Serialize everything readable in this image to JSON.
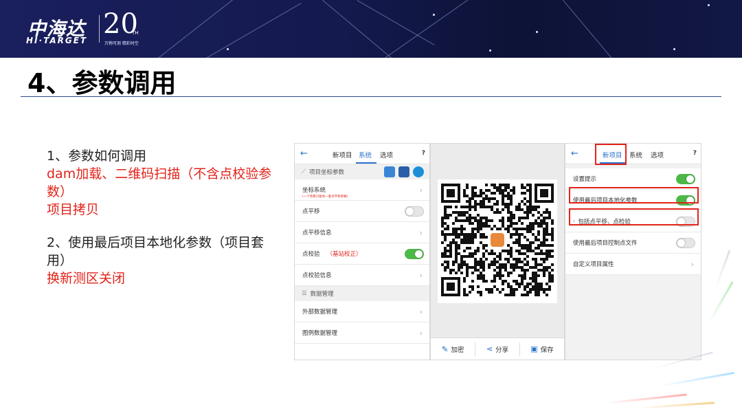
{
  "header": {
    "logo_cn": "中海达",
    "logo_en": "HI·TARGET",
    "anniv": "20",
    "anniv_suffix": "TH",
    "tagline": "万物可测 精彩时空"
  },
  "slide": {
    "title": "4、参数调用"
  },
  "left_text": {
    "item1_heading": "1、参数如何调用",
    "item1_red_a": "dam加载、二维码扫描（不含点校验参数）",
    "item1_red_b": "项目拷贝",
    "item2_heading": "2、使用最后项目本地化参数（项目套用）",
    "item2_red": "换新测区关闭"
  },
  "panel1": {
    "back": "←",
    "tabs": [
      "新项目",
      "系统",
      "选项"
    ],
    "help": "?",
    "section1": "项目坐标参数",
    "rows": [
      {
        "label": "坐标系统",
        "note": "(一个项目只能有一套点平移参数)"
      },
      {
        "label": "点平移"
      },
      {
        "label": "点平移信息"
      },
      {
        "label": "点校验",
        "extra": "（基站校正）"
      },
      {
        "label": "点校验信息"
      }
    ],
    "section2": "数据管理",
    "rows2": [
      {
        "label": "外部数据管理"
      },
      {
        "label": "图例数据管理"
      }
    ]
  },
  "panel2": {
    "buttons": [
      "加密",
      "分享",
      "保存"
    ]
  },
  "panel3": {
    "back": "←",
    "tabs": [
      "新项目",
      "系统",
      "选项"
    ],
    "help": "?",
    "rows": [
      {
        "label": "设置提示",
        "on": true
      },
      {
        "label": "使用最后项目本地化参数",
        "on": true
      },
      {
        "label": "包括点平移、点检验",
        "on": false
      },
      {
        "label": "使用最后项目控制点文件",
        "on": false
      },
      {
        "label": "自定义项目属性"
      }
    ]
  },
  "colors": {
    "accent_blue": "#2a73c9",
    "highlight_red": "#e2231a",
    "toggle_on": "#4cb848",
    "banner": "#141a4e"
  }
}
